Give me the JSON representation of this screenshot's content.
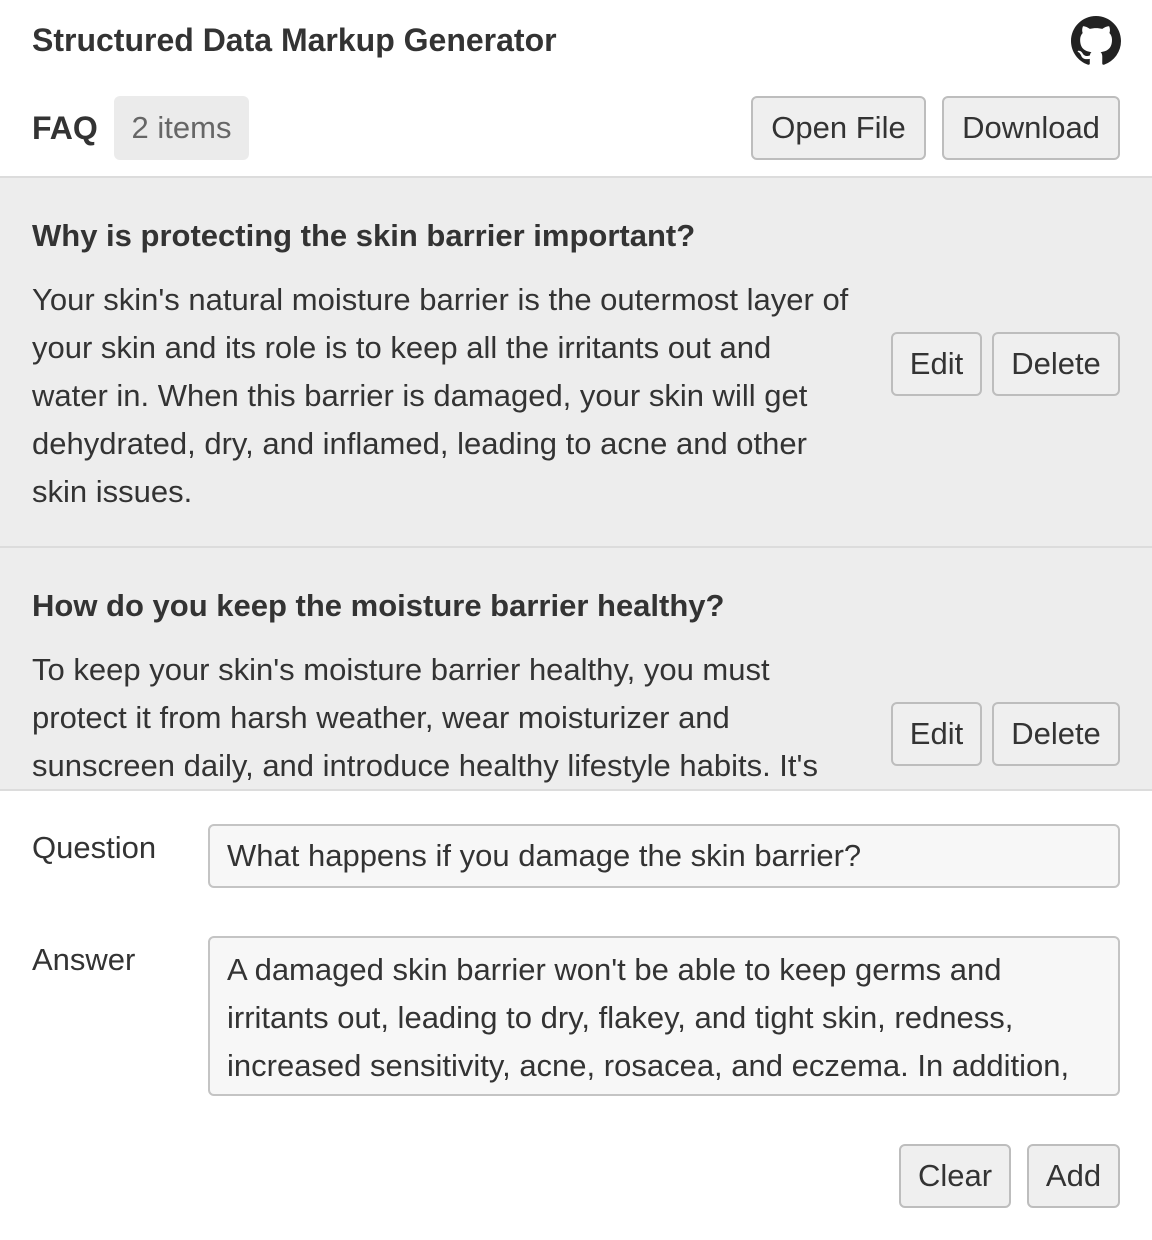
{
  "header": {
    "title": "Structured Data Markup Generator",
    "github_icon": "github-icon"
  },
  "toolbar": {
    "section_label": "FAQ",
    "item_count": "2 items",
    "open_file_label": "Open File",
    "download_label": "Download"
  },
  "faq_items": [
    {
      "question": "Why is protecting the skin barrier important?",
      "answer": "Your skin's natural moisture barrier is the outermost layer of your skin and its role is to keep all the irritants out and water in. When this barrier is damaged, your skin will get dehydrated, dry, and inflamed, leading to acne and other skin issues.",
      "edit_label": "Edit",
      "delete_label": "Delete"
    },
    {
      "question": "How do you keep the moisture barrier healthy?",
      "answer": "To keep your skin's moisture barrier healthy, you must protect it from harsh weather, wear moisturizer and sunscreen daily, and introduce healthy lifestyle habits. It's",
      "edit_label": "Edit",
      "delete_label": "Delete"
    }
  ],
  "form": {
    "question_label": "Question",
    "question_value": "What happens if you damage the skin barrier?",
    "answer_label": "Answer",
    "answer_value": "A damaged skin barrier won't be able to keep germs and irritants out, leading to dry, flakey, and tight skin, redness, increased sensitivity, acne, rosacea, and eczema. In addition,",
    "clear_label": "Clear",
    "add_label": "Add"
  }
}
